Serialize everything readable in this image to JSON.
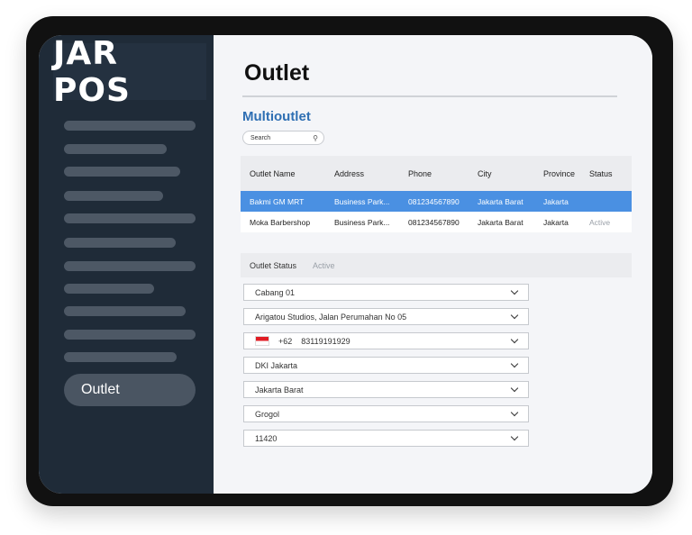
{
  "sidebar": {
    "logo": "JAR POS",
    "active_item": "Outlet"
  },
  "main": {
    "title": "Outlet",
    "section_title": "Multioutlet",
    "search_placeholder": "Search",
    "table": {
      "headers": [
        "Outlet Name",
        "Address",
        "Phone",
        "City",
        "Province",
        "Status"
      ],
      "rows": [
        {
          "name": "Bakmi GM MRT",
          "address": "Business Park...",
          "phone": "081234567890",
          "city": "Jakarta Barat",
          "province": "Jakarta",
          "status": ""
        },
        {
          "name": "Moka Barbershop",
          "address": "Business Park...",
          "phone": "081234567890",
          "city": "Jakarta Barat",
          "province": "Jakarta",
          "status": "Active"
        }
      ]
    },
    "outlet_status": {
      "label": "Outlet Status",
      "value": "Active"
    },
    "form": {
      "outlet": "Cabang 01",
      "address": "Arigatou Studios, Jalan Perumahan No 05",
      "phone_code": "+62",
      "phone_number": "83119191929",
      "province": "DKI Jakarta",
      "city": "Jakarta Barat",
      "district": "Grogol",
      "postal_code": "11420"
    }
  },
  "colors": {
    "sidebar_bg": "#1f2b38",
    "accent": "#2f6fb3",
    "selected_row": "#4a90e2"
  }
}
